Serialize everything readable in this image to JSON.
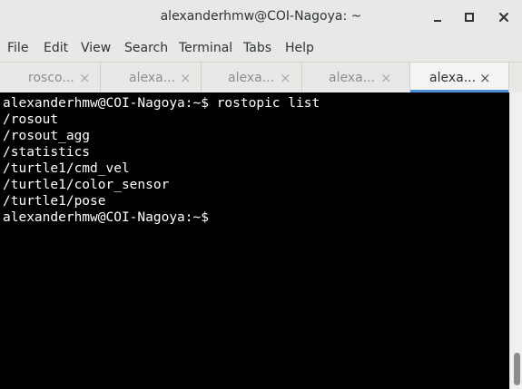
{
  "window": {
    "title": "alexanderhmw@COI-Nagoya: ~"
  },
  "window_controls": {
    "minimize_icon": "minimize-icon",
    "maximize_icon": "maximize-icon",
    "close_icon": "close-icon"
  },
  "menubar": {
    "items": [
      {
        "label": "File"
      },
      {
        "label": "Edit"
      },
      {
        "label": "View"
      },
      {
        "label": "Search"
      },
      {
        "label": "Terminal"
      },
      {
        "label": "Tabs"
      },
      {
        "label": "Help"
      }
    ]
  },
  "tabs": [
    {
      "label": "rosco...",
      "close": "×",
      "active": false
    },
    {
      "label": "alexa...",
      "close": "×",
      "active": false
    },
    {
      "label": "alexa...",
      "close": "×",
      "active": false
    },
    {
      "label": "alexa...",
      "close": "×",
      "active": false
    },
    {
      "label": "alexa...",
      "close": "×",
      "active": true
    }
  ],
  "terminal": {
    "lines": [
      "alexanderhmw@COI-Nagoya:~$ rostopic list",
      "/rosout",
      "/rosout_agg",
      "/statistics",
      "/turtle1/cmd_vel",
      "/turtle1/color_sensor",
      "/turtle1/pose",
      "alexanderhmw@COI-Nagoya:~$ "
    ]
  },
  "colors": {
    "terminal_bg": "#000000",
    "terminal_fg": "#ffffff",
    "chrome_bg": "#e8e8e7",
    "active_tab_accent": "#4a90d9"
  }
}
